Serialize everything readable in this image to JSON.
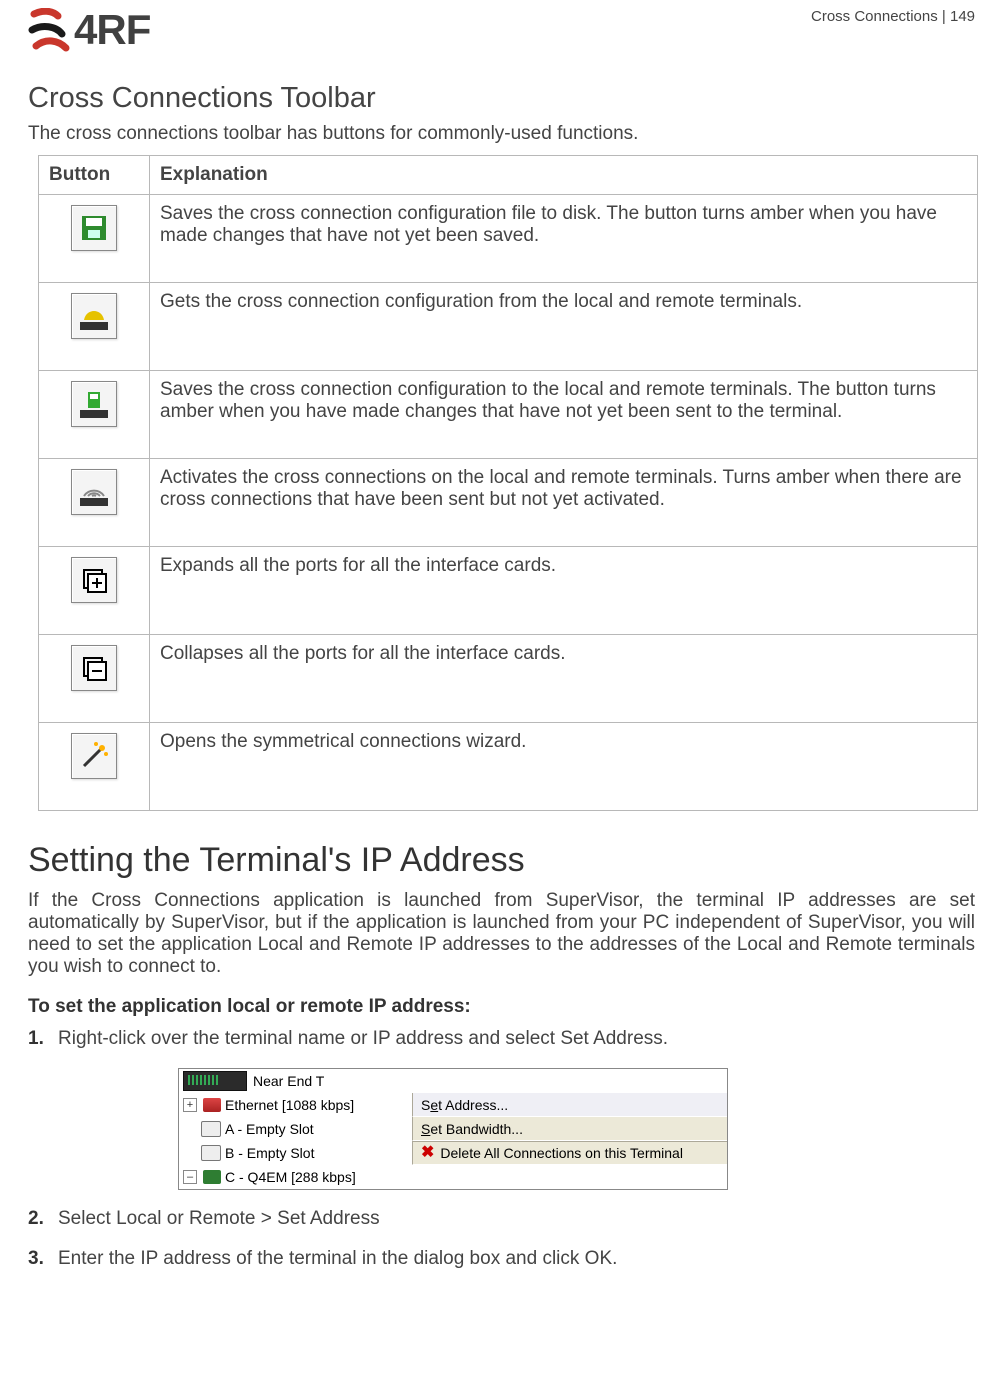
{
  "header": {
    "logo_text": "4RF",
    "page_info": "Cross Connections  |  149"
  },
  "section1": {
    "title": "Cross Connections Toolbar",
    "intro": "The cross connections toolbar has buttons for commonly-used functions."
  },
  "table": {
    "col_button": "Button",
    "col_explanation": "Explanation",
    "rows": [
      {
        "icon": "save-disk-icon",
        "text": "Saves the cross connection configuration file to disk. The button turns amber when you have made changes that have not yet been saved."
      },
      {
        "icon": "get-config-icon",
        "text": "Gets the cross connection configuration from the local and remote terminals."
      },
      {
        "icon": "send-config-icon",
        "text": "Saves the cross connection configuration to the local and remote terminals. The button turns amber when you have made changes that have not yet been sent to the terminal."
      },
      {
        "icon": "activate-icon",
        "text": "Activates the cross connections on the local and remote terminals. Turns amber when there are cross connections that have been sent but not yet activated."
      },
      {
        "icon": "expand-all-icon",
        "text": "Expands all the ports for all the interface cards."
      },
      {
        "icon": "collapse-all-icon",
        "text": "Collapses all the ports for all the interface cards."
      },
      {
        "icon": "wizard-icon",
        "text": "Opens the symmetrical connections wizard."
      }
    ]
  },
  "section2": {
    "title": "Setting the Terminal's IP Address",
    "para": "If the Cross Connections application is launched from SuperVisor, the terminal IP addresses are set automatically by SuperVisor, but if the application is launched from your PC independent of SuperVisor, you will need to set the application Local and Remote IP addresses to the addresses of the Local and Remote terminals you wish to connect to.",
    "subhead": "To set the application local or remote IP address:",
    "steps": [
      "Right-click over the terminal name or IP address and select Set Address.",
      "Select Local or Remote > Set Address",
      "Enter the IP address of the terminal in the dialog box and click OK."
    ]
  },
  "shot": {
    "near_end": "Near End T",
    "tree": {
      "ethernet": "Ethernet [1088 kbps]",
      "slot_a": "A - Empty Slot",
      "slot_b": "B - Empty Slot",
      "slot_c": "C - Q4EM [288 kbps]"
    },
    "menu": {
      "set_address_pre": "S",
      "set_address_u": "e",
      "set_address_post": "t Address...",
      "set_bw_pre": "",
      "set_bw_u": "S",
      "set_bw_post": "et Bandwidth...",
      "delete_all": "Delete All Connections on this Terminal"
    }
  }
}
